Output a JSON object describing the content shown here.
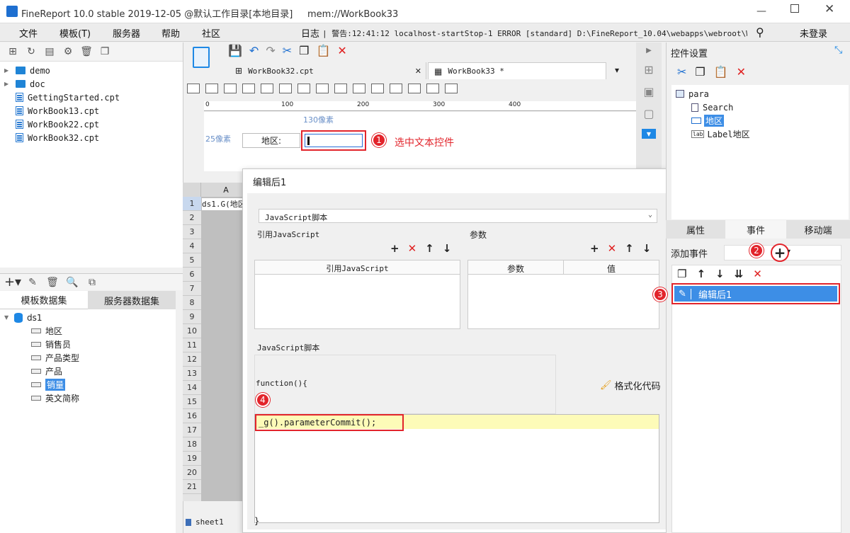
{
  "window": {
    "title": "FineReport 10.0 stable 2019-12-05 @默认工作目录[本地目录]     mem://WorkBook33"
  },
  "menu": {
    "items": [
      "文件",
      "模板(T)",
      "服务器",
      "帮助",
      "社区"
    ],
    "log_label": "日志",
    "warning_text": "| 警告:12:41:12 localhost-startStop-1 ERROR [standard] D:\\FineReport_10.04\\webapps\\webroot\\W...",
    "login_label": "未登录"
  },
  "file_tree": {
    "items": [
      "demo",
      "doc",
      "GettingStarted.cpt",
      "WorkBook13.cpt",
      "WorkBook22.cpt",
      "WorkBook32.cpt"
    ]
  },
  "dataset_panel": {
    "tabs": [
      "模板数据集",
      "服务器数据集"
    ],
    "dataset_name": "ds1",
    "fields": [
      "地区",
      "销售员",
      "产品类型",
      "产品",
      "销量",
      "英文简称"
    ],
    "selected_field": "销量"
  },
  "doc_tabs": [
    "WorkBook32.cpt",
    "WorkBook33 *"
  ],
  "canvas": {
    "ruler_labels": [
      "0",
      "100",
      "200",
      "300",
      "400"
    ],
    "width_hint": "130像素",
    "height_hint": "25像素",
    "label_widget": "地区:",
    "annotation_1": "选中文本控件"
  },
  "sheet": {
    "col_header": "A",
    "rows": [
      "1",
      "2",
      "3",
      "4",
      "5",
      "6",
      "7",
      "8",
      "9",
      "10",
      "11",
      "12",
      "13",
      "14",
      "15",
      "16",
      "17",
      "18",
      "19",
      "20",
      "21"
    ],
    "cell_a1": "ds1.G(地区",
    "sheet_tab": "sheet1"
  },
  "dialog": {
    "title": "编辑后1",
    "type_value": "JavaScript脚本",
    "ref_js_title": "引用JavaScript",
    "params_title": "参数",
    "ref_js_col": "引用JavaScript",
    "param_col": "参数",
    "value_col": "值",
    "script_title": "JavaScript脚本",
    "function_open": "function(){",
    "format_label": "格式化代码",
    "code_line": "_g().parameterCommit();",
    "function_close": "}"
  },
  "right_panel": {
    "title": "控件设置",
    "tree": [
      "para",
      "Search",
      "地区",
      "Label地区"
    ],
    "selected": "地区",
    "tabs": [
      "属性",
      "事件",
      "移动端"
    ],
    "active_tab": "事件",
    "add_event_label": "添加事件",
    "event_item": "编辑后1"
  },
  "badges": [
    "1",
    "2",
    "3",
    "4"
  ],
  "colors": {
    "accent": "#1e88e5",
    "selected_event": "#3d8ee6",
    "badge": "#e2242b",
    "code_highlight": "#fdfbb8"
  }
}
